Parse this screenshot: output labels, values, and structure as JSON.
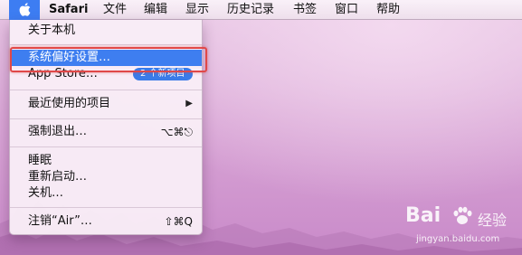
{
  "menubar": {
    "apple_icon": "apple-logo",
    "app_name": "Safari",
    "items": [
      "文件",
      "编辑",
      "显示",
      "历史记录",
      "书签",
      "窗口",
      "帮助"
    ]
  },
  "apple_menu": {
    "about": "关于本机",
    "preferences": "系统偏好设置…",
    "app_store": "App Store…",
    "app_store_badge": "2 个新项目",
    "recent_items": "最近使用的项目",
    "recent_items_arrow": "▶",
    "force_quit": "强制退出…",
    "force_quit_shortcut": "⌥⌘⎋",
    "sleep": "睡眠",
    "restart": "重新启动…",
    "shutdown": "关机…",
    "logout": "注销“Air”…",
    "logout_shortcut": "⇧⌘Q"
  },
  "highlight": {
    "selected_item": "系统偏好设置…",
    "selection_color": "#3e7ef0",
    "frame_color": "#e04848"
  },
  "watermark": {
    "brand": "Bai",
    "brand_suffix": "经验",
    "url": "jingyan.baidu.com"
  }
}
